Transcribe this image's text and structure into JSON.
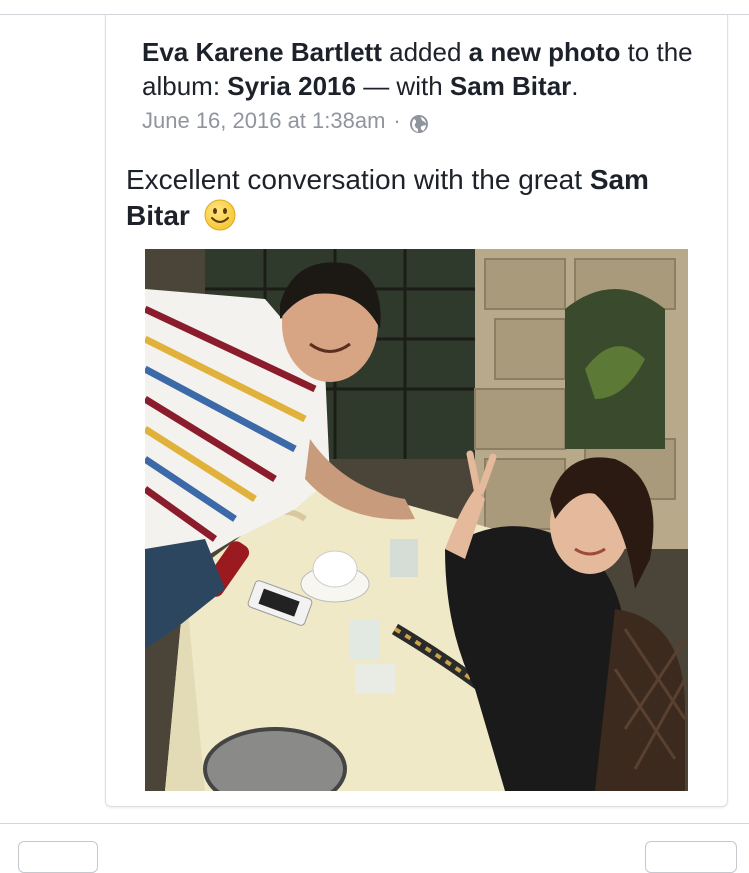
{
  "post": {
    "author": "Eva Karene Bartlett",
    "action_text": "added",
    "object_text": "a new photo",
    "to_text": "to the album:",
    "album": "Syria 2016",
    "with_text": "— with",
    "tagged": "Sam Bitar",
    "period": ".",
    "timestamp": "June 16, 2016 at 1:38am",
    "separator": "·",
    "privacy_icon": "globe-icon",
    "caption_text": "Excellent conversation with the great",
    "caption_mention": "Sam Bitar",
    "caption_emoji": "smiley-icon"
  },
  "colors": {
    "text": "#1d2129",
    "secondary": "#90949c",
    "border": "#dddfe2"
  }
}
